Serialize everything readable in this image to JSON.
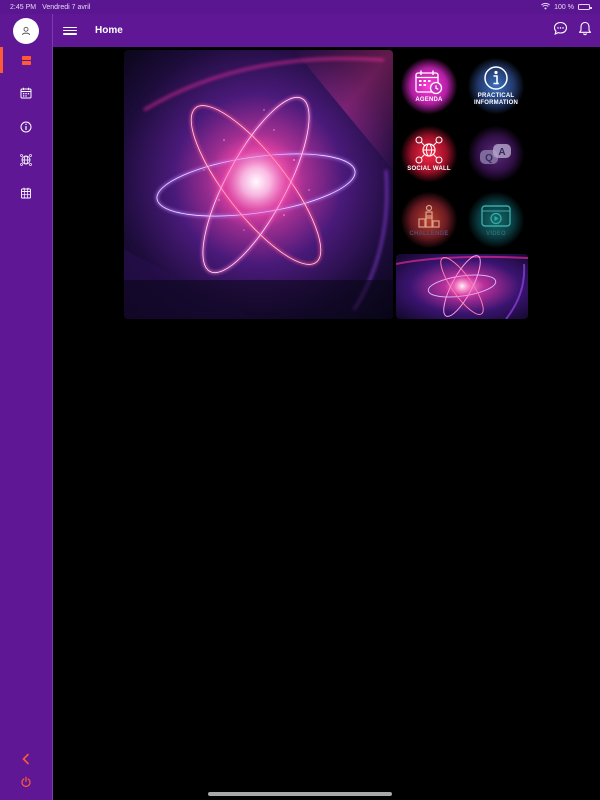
{
  "status_bar": {
    "time": "2:45 PM",
    "date": "Vendredi 7 avril",
    "battery": "100 %"
  },
  "header": {
    "title": "Home",
    "menu_icon": "hamburger-icon",
    "chat_icon": "chat-bubble-icon",
    "notification_icon": "bell-icon"
  },
  "sidebar": {
    "items": [
      {
        "name": "home",
        "icon": "home-icon",
        "active": true
      },
      {
        "name": "agenda",
        "icon": "calendar-icon"
      },
      {
        "name": "info",
        "icon": "info-icon"
      },
      {
        "name": "social",
        "icon": "globe-icon"
      },
      {
        "name": "challenge",
        "icon": "calendar-grid-icon"
      }
    ],
    "collapse_icon": "chevron-left-icon",
    "logout_icon": "power-icon"
  },
  "tiles": [
    {
      "label": "AGENDA",
      "icon": "calendar-clock-icon"
    },
    {
      "label": "PRACTICAL\nINFORMATION",
      "icon": "info-circle-icon"
    },
    {
      "label": "SOCIAL WALL",
      "icon": "network-globe-icon"
    },
    {
      "label": "",
      "icon": "qa-bubbles-icon"
    },
    {
      "label": "CHALLENGE",
      "icon": "podium-icon"
    },
    {
      "label": "VIDEO",
      "icon": "video-play-icon"
    }
  ],
  "colors": {
    "purple": "#5f1795",
    "accent": "#ff5a36",
    "background": "#000000"
  }
}
